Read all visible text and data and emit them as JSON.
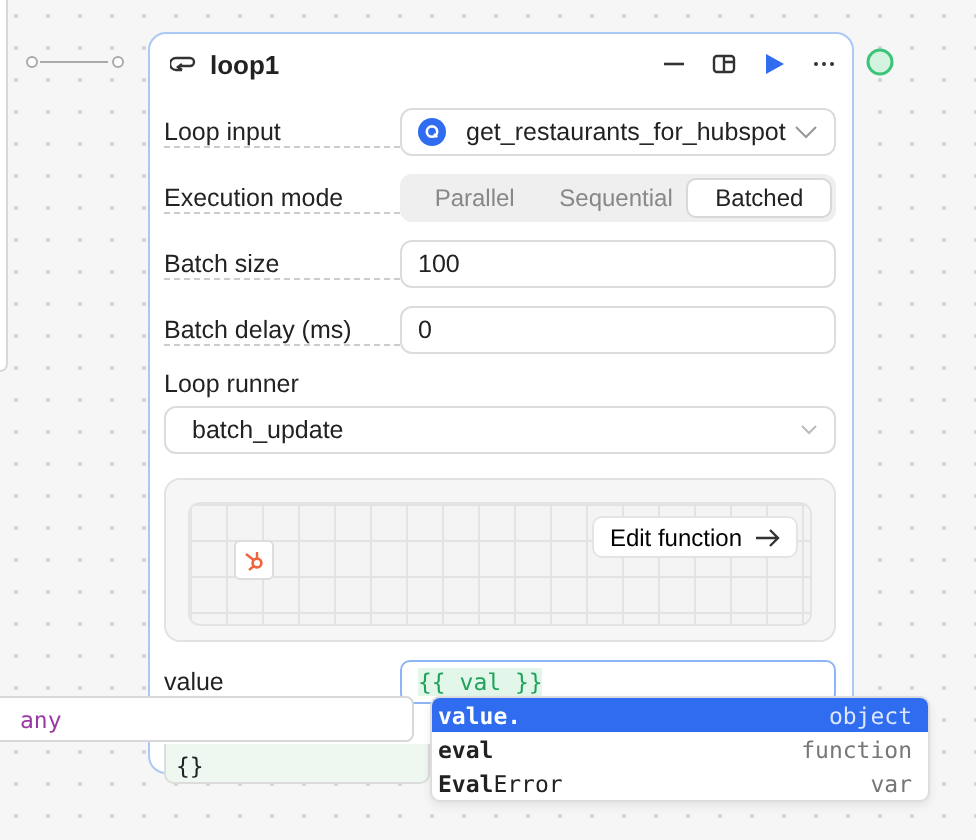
{
  "node": {
    "title": "loop1",
    "fields": [
      {
        "kind": "select",
        "label": "Loop input",
        "value": "get_restaurants_for_hubspot"
      },
      {
        "kind": "segmented",
        "label": "Execution mode",
        "options": [
          {
            "label": "Parallel",
            "selected": false
          },
          {
            "label": "Sequential",
            "selected": false
          },
          {
            "label": "Batched",
            "selected": true
          }
        ]
      },
      {
        "kind": "input",
        "label": "Batch size",
        "value": "100"
      },
      {
        "kind": "input",
        "label": "Batch delay (ms)",
        "value": "0"
      }
    ],
    "runner": {
      "label": "Loop runner",
      "value": "batch_update"
    },
    "preview": {
      "button": "Edit function"
    },
    "value_field": {
      "label": "value",
      "value": "{{ val }}"
    },
    "result": "{}"
  },
  "type_hint": "any",
  "autocomplete": [
    {
      "label": "**value.**",
      "type": "object",
      "selected": true
    },
    {
      "label": "**eval**",
      "type": "function",
      "selected": false
    },
    {
      "label": "**Eval**Error",
      "type": "var",
      "selected": false
    }
  ]
}
